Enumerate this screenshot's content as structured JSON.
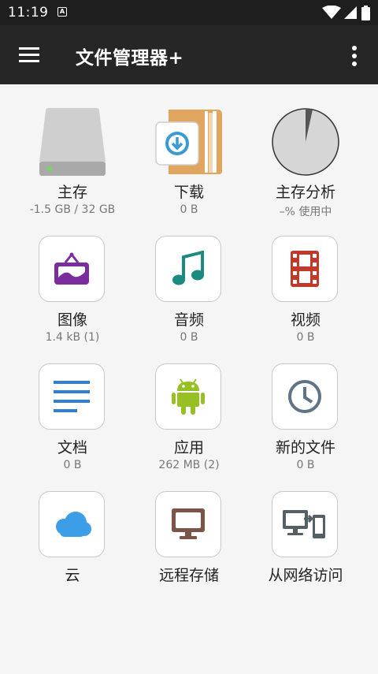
{
  "status_bar": {
    "time": "11:19",
    "badge": "A"
  },
  "app_bar": {
    "title": "文件管理器+",
    "menu_icon": "hamburger-menu-icon",
    "more_icon": "more-vert-icon"
  },
  "tiles": [
    {
      "label": "主存",
      "sub": "-1.5 GB / 32 GB",
      "icon": "hard-drive-icon"
    },
    {
      "label": "下载",
      "sub": "0 B",
      "icon": "download-folder-icon"
    },
    {
      "label": "主存分析",
      "sub": "–% 使用中",
      "icon": "pie-chart-icon"
    },
    {
      "label": "图像",
      "sub": "1.4 kB (1)",
      "icon": "image-frame-icon"
    },
    {
      "label": "音频",
      "sub": "0 B",
      "icon": "music-note-icon"
    },
    {
      "label": "视频",
      "sub": "0 B",
      "icon": "film-strip-icon"
    },
    {
      "label": "文档",
      "sub": "0 B",
      "icon": "document-lines-icon"
    },
    {
      "label": "应用",
      "sub": "262 MB (2)",
      "icon": "android-icon"
    },
    {
      "label": "新的文件",
      "sub": "0 B",
      "icon": "clock-icon"
    },
    {
      "label": "云",
      "sub": "",
      "icon": "cloud-icon"
    },
    {
      "label": "远程存储",
      "sub": "",
      "icon": "monitor-icon"
    },
    {
      "label": "从网络访问",
      "sub": "",
      "icon": "devices-transfer-icon"
    }
  ],
  "colors": {
    "app_bar": "#262626",
    "status_bar": "#1e1e1e",
    "background": "#f5f5f5",
    "image_purple": "#7a2e9e",
    "audio_teal": "#1b8a80",
    "video_red": "#c0392b",
    "docs_blue": "#2f7fd4",
    "android_green": "#97c024",
    "clock_slate": "#5f7486",
    "cloud_blue": "#3d9ee8",
    "remote_brown": "#7d5548",
    "network_gray": "#556066"
  }
}
